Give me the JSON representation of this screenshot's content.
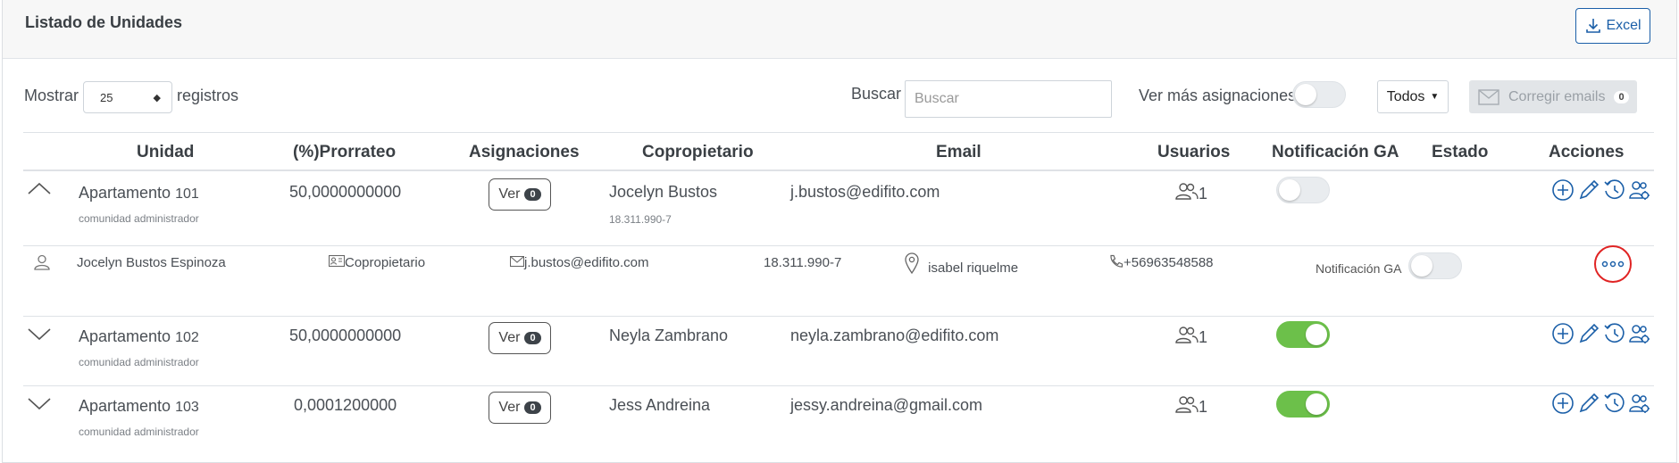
{
  "header": {
    "title": "Listado de Unidades",
    "excel_label": "Excel"
  },
  "controls": {
    "show_label": "Mostrar",
    "page_size": "25",
    "records_label": "registros",
    "search_label": "Buscar",
    "search_placeholder": "Buscar",
    "more_assign_label": "Ver más asignaciones",
    "filter_label": "Todos",
    "fix_emails_label": "Corregir emails",
    "fix_emails_count": "0"
  },
  "columns": [
    "Unidad",
    "(%)Prorrateo",
    "Asignaciones",
    "Copropietario",
    "Email",
    "Usuarios",
    "Notificación GA",
    "Estado",
    "Acciones"
  ],
  "rows": [
    {
      "unit_prefix": "Apartamento ",
      "unit_num": "101",
      "unit_sub": "comunidad administrador",
      "prorrateo": "50,0000000000",
      "ver_label": "Ver",
      "ver_count": "0",
      "owner": "Jocelyn Bustos",
      "owner_rut": "18.311.990-7",
      "email": "j.bustos@edifito.com",
      "users": "1",
      "notification_on": false
    },
    {
      "unit_prefix": "Apartamento ",
      "unit_num": "102",
      "unit_sub": "comunidad administrador",
      "prorrateo": "50,0000000000",
      "ver_label": "Ver",
      "ver_count": "0",
      "owner": "Neyla Zambrano",
      "owner_rut": "",
      "email": "neyla.zambrano@edifito.com",
      "users": "1",
      "notification_on": true
    },
    {
      "unit_prefix": "Apartamento ",
      "unit_num": "103",
      "unit_sub": "comunidad administrador",
      "prorrateo": "0,0001200000",
      "ver_label": "Ver",
      "ver_count": "0",
      "owner": "Jess Andreina",
      "email": "jessy.andreina@gmail.com",
      "users": "1",
      "notification_on": true
    }
  ],
  "detail": {
    "name": "Jocelyn Bustos Espinoza",
    "role": "Copropietario",
    "email": "j.bustos@edifito.com",
    "rut": "18.311.990-7",
    "address": "isabel riquelme",
    "phone": "+56963548588",
    "notif_label": "Notificación GA"
  },
  "colors": {
    "accent": "#1b5fa8",
    "toggle_on": "#6cc04a",
    "highlight": "#e02424"
  }
}
